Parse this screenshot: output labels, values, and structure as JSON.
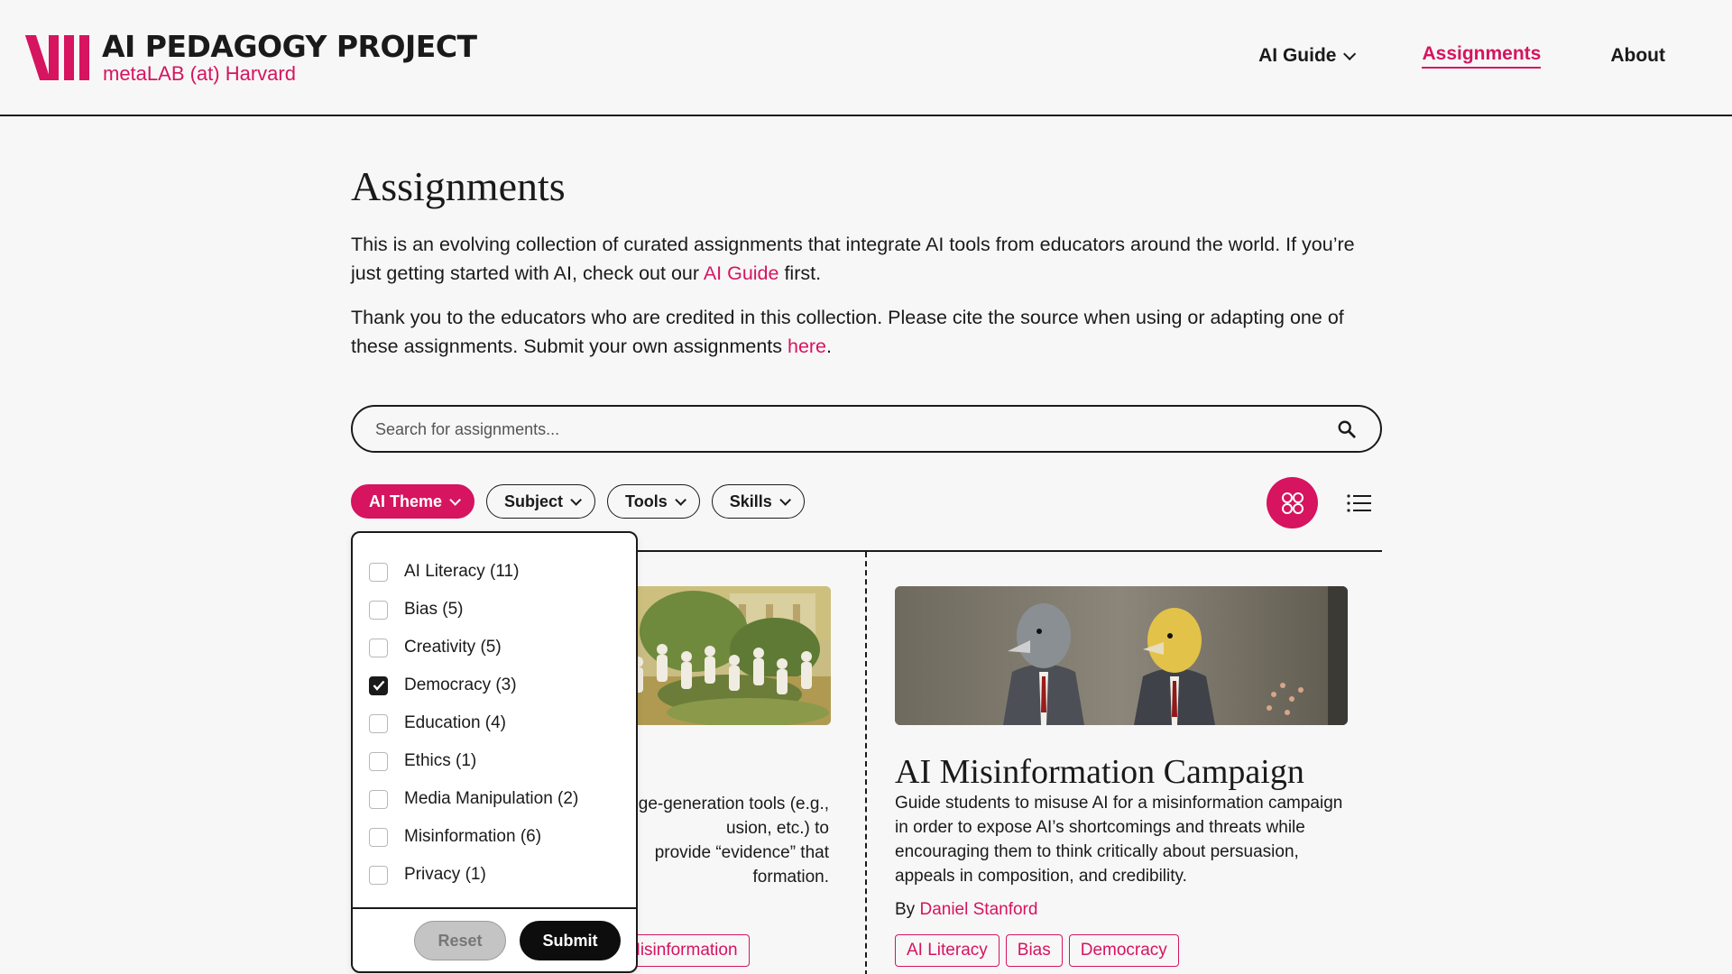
{
  "brand": {
    "title": "AI PEDAGOGY PROJECT",
    "subtitle": "metaLAB (at) Harvard",
    "accent": "#d6145f"
  },
  "nav": {
    "ai_guide": "AI Guide",
    "assignments": "Assignments",
    "about": "About"
  },
  "page": {
    "title": "Assignments",
    "intro1_a": "This is an evolving collection of curated assignments that integrate AI tools from educators around the world. If you’re just getting started with AI, check out our ",
    "intro1_link": "AI Guide",
    "intro1_b": " first.",
    "intro2_a": "Thank you to the educators who are credited in this collection. Please cite the source when using or adapting one of these assignments. Submit your own assignments ",
    "intro2_link": "here",
    "intro2_b": "."
  },
  "search": {
    "placeholder": "Search for assignments..."
  },
  "filters": {
    "ai_theme": "AI Theme",
    "subject": "Subject",
    "tools": "Tools",
    "skills": "Skills"
  },
  "dropdown": {
    "items": [
      {
        "label": "AI Literacy (11)",
        "checked": false
      },
      {
        "label": "Bias (5)",
        "checked": false
      },
      {
        "label": "Creativity (5)",
        "checked": false
      },
      {
        "label": "Democracy (3)",
        "checked": true
      },
      {
        "label": "Education (4)",
        "checked": false
      },
      {
        "label": "Ethics (1)",
        "checked": false
      },
      {
        "label": "Media Manipulation (2)",
        "checked": false
      },
      {
        "label": "Misinformation (6)",
        "checked": false
      },
      {
        "label": "Privacy (1)",
        "checked": false
      }
    ],
    "reset": "Reset",
    "submit": "Submit"
  },
  "card_left": {
    "desc_lines": [
      "ge-generation tools (e.g.,",
      "usion, etc.) to",
      "provide “evidence” that",
      "formation."
    ],
    "tag": "Misinformation"
  },
  "card_right": {
    "title": "AI Misinformation Campaign",
    "desc": "Guide students to misuse AI for a misinformation campaign in order to expose AI’s shortcomings and threats while encouraging them to think critically about persuasion, appeals in composition, and credibility.",
    "by_label": "By",
    "author": "Daniel Stanford",
    "tags": [
      "AI Literacy",
      "Bias",
      "Democracy"
    ]
  }
}
